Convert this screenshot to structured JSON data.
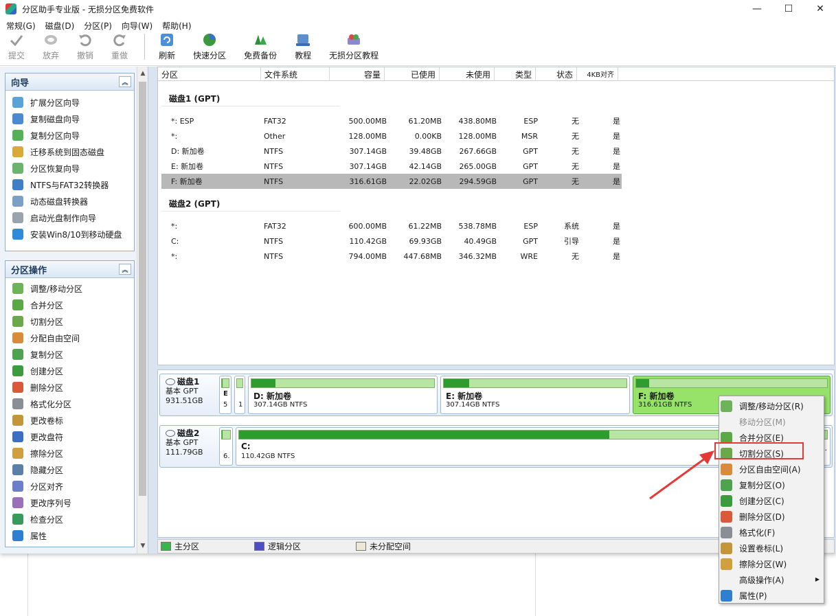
{
  "window": {
    "title": "分区助手专业版 - 无损分区免费软件",
    "controls": {
      "minimize": "—",
      "maximize": "☐",
      "close": "✕"
    }
  },
  "menubar": [
    "常规(G)",
    "磁盘(D)",
    "分区(P)",
    "向导(W)",
    "帮助(H)"
  ],
  "toolbar": {
    "submit": "提交",
    "discard": "放弃",
    "undo": "撤销",
    "redo": "重做",
    "refresh": "刷新",
    "quick_partition": "快速分区",
    "free_backup": "免费备份",
    "tutorial": "教程",
    "lossless_tutorial": "无损分区教程"
  },
  "sidebar": {
    "wizard_title": "向导",
    "wizard_items": [
      "扩展分区向导",
      "复制磁盘向导",
      "复制分区向导",
      "迁移系统到固态磁盘",
      "分区恢复向导",
      "NTFS与FAT32转换器",
      "动态磁盘转换器",
      "启动光盘制作向导",
      "安装Win8/10到移动硬盘"
    ],
    "ops_title": "分区操作",
    "ops_items": [
      "调整/移动分区",
      "合并分区",
      "切割分区",
      "分配自由空间",
      "复制分区",
      "创建分区",
      "删除分区",
      "格式化分区",
      "更改卷标",
      "更改盘符",
      "擦除分区",
      "隐藏分区",
      "分区对齐",
      "更改序列号",
      "检查分区",
      "属性"
    ]
  },
  "table": {
    "headers": {
      "partition": "分区",
      "fs": "文件系统",
      "capacity": "容量",
      "used": "已使用",
      "free": "未使用",
      "type": "类型",
      "state": "状态",
      "align": "4KB对齐"
    },
    "disk1": {
      "title": "磁盘1 (GPT)",
      "rows": [
        {
          "name": "*: ESP",
          "fs": "FAT32",
          "cap": "500.00MB",
          "used": "61.20MB",
          "free": "438.80MB",
          "type": "ESP",
          "state": "无",
          "align": "是"
        },
        {
          "name": "*:",
          "fs": "Other",
          "cap": "128.00MB",
          "used": "0.00KB",
          "free": "128.00MB",
          "type": "MSR",
          "state": "无",
          "align": "是"
        },
        {
          "name": "D: 新加卷",
          "fs": "NTFS",
          "cap": "307.14GB",
          "used": "39.48GB",
          "free": "267.66GB",
          "type": "GPT",
          "state": "无",
          "align": "是"
        },
        {
          "name": "E: 新加卷",
          "fs": "NTFS",
          "cap": "307.14GB",
          "used": "42.14GB",
          "free": "265.00GB",
          "type": "GPT",
          "state": "无",
          "align": "是"
        },
        {
          "name": "F: 新加卷",
          "fs": "NTFS",
          "cap": "316.61GB",
          "used": "22.02GB",
          "free": "294.59GB",
          "type": "GPT",
          "state": "无",
          "align": "是"
        }
      ]
    },
    "disk2": {
      "title": "磁盘2 (GPT)",
      "rows": [
        {
          "name": "*:",
          "fs": "FAT32",
          "cap": "600.00MB",
          "used": "61.22MB",
          "free": "538.78MB",
          "type": "ESP",
          "state": "系统",
          "align": "是"
        },
        {
          "name": "C:",
          "fs": "NTFS",
          "cap": "110.42GB",
          "used": "69.93GB",
          "free": "40.49GB",
          "type": "GPT",
          "state": "引导",
          "align": "是"
        },
        {
          "name": "*:",
          "fs": "NTFS",
          "cap": "794.00MB",
          "used": "447.68MB",
          "free": "346.32MB",
          "type": "WRE",
          "state": "无",
          "align": "是"
        }
      ]
    }
  },
  "diskmap": {
    "disk1": {
      "name": "磁盘1",
      "type": "基本 GPT",
      "size": "931.51GB",
      "small1": {
        "lbl": "E",
        "sub": "5"
      },
      "small2": {
        "lbl": "",
        "sub": "1"
      },
      "d": {
        "lbl": "D: 新加卷",
        "sub": "307.14GB NTFS",
        "used_pct": 13
      },
      "e": {
        "lbl": "E: 新加卷",
        "sub": "307.14GB NTFS",
        "used_pct": 14
      },
      "f": {
        "lbl": "F: 新加卷",
        "sub": "316.61GB NTFS",
        "used_pct": 7
      }
    },
    "disk2": {
      "name": "磁盘2",
      "type": "基本 GPT",
      "size": "111.79GB",
      "small1": {
        "lbl": "",
        "sub": "6."
      },
      "c": {
        "lbl": "C:",
        "sub": "110.42GB NTFS",
        "used_pct": 63
      },
      "tail": ".."
    }
  },
  "legend": {
    "primary": "主分区",
    "logical": "逻辑分区",
    "unallocated": "未分配空间"
  },
  "context_menu": [
    "调整/移动分区(R)",
    "移动分区(M)",
    "合并分区(E)",
    "切割分区(S)",
    "分区自由空间(A)",
    "复制分区(O)",
    "创建分区(C)",
    "删除分区(D)",
    "格式化(F)",
    "设置卷标(L)",
    "擦除分区(W)",
    "高级操作(A)",
    "属性(P)"
  ],
  "colors": {
    "primary": "#2f9c2f",
    "highlight": "#97e36a",
    "annotation": "#e53935"
  }
}
